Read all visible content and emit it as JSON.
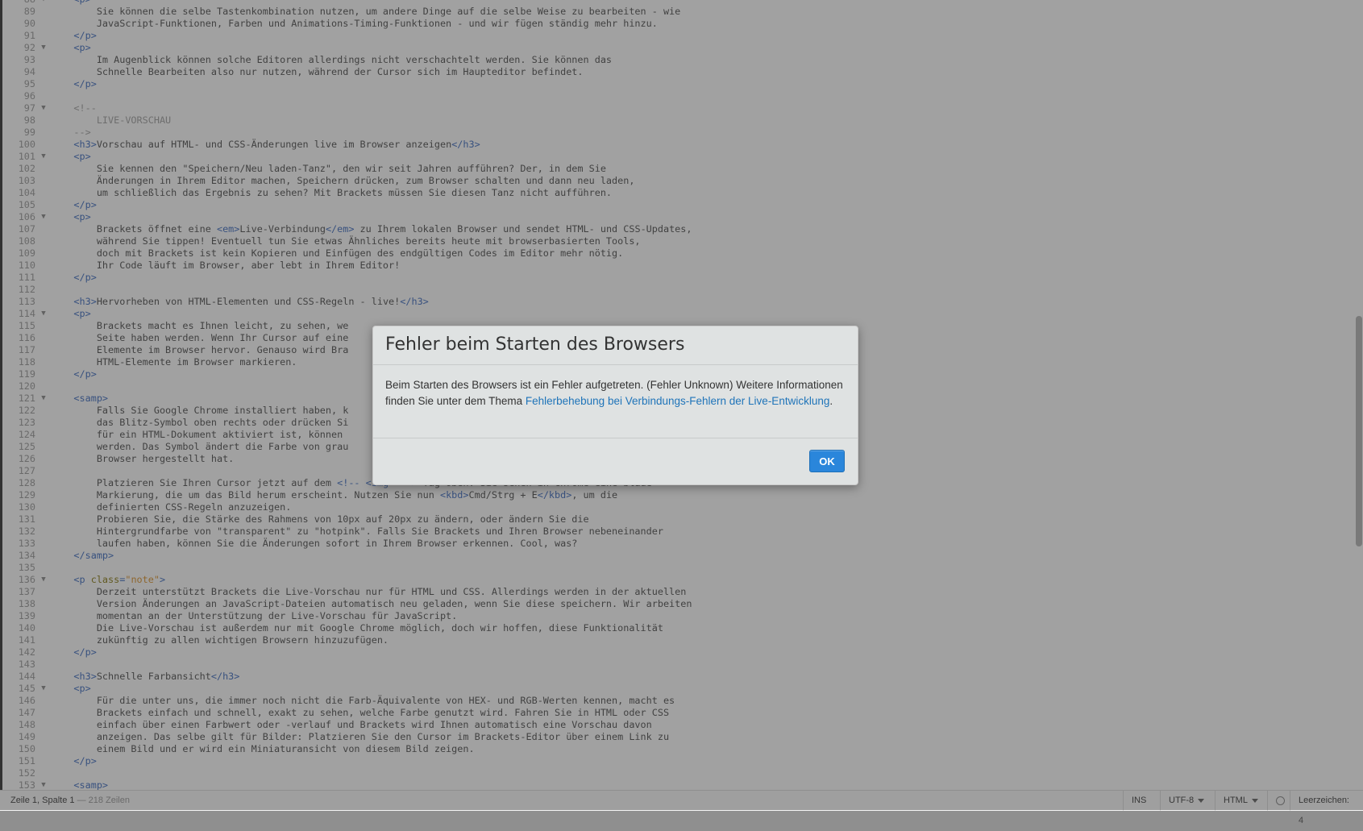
{
  "editor": {
    "lines": [
      {
        "n": "88",
        "fold": true,
        "parts": [
          [
            "tag",
            "    <p>"
          ]
        ]
      },
      {
        "n": "89",
        "parts": [
          [
            "txt",
            "        Sie können die selbe Tastenkombination nutzen, um andere Dinge auf die selbe Weise zu bearbeiten - wie"
          ]
        ]
      },
      {
        "n": "90",
        "parts": [
          [
            "txt",
            "        JavaScript-Funktionen, Farben und Animations-Timing-Funktionen - und wir fügen ständig mehr hinzu."
          ]
        ]
      },
      {
        "n": "91",
        "parts": [
          [
            "tag",
            "    </p>"
          ]
        ]
      },
      {
        "n": "92",
        "fold": true,
        "parts": [
          [
            "tag",
            "    <p>"
          ]
        ]
      },
      {
        "n": "93",
        "parts": [
          [
            "txt",
            "        Im Augenblick können solche Editoren allerdings nicht verschachtelt werden. Sie können das"
          ]
        ]
      },
      {
        "n": "94",
        "parts": [
          [
            "txt",
            "        Schnelle Bearbeiten also nur nutzen, während der Cursor sich im Haupteditor befindet."
          ]
        ]
      },
      {
        "n": "95",
        "parts": [
          [
            "tag",
            "    </p>"
          ]
        ]
      },
      {
        "n": "96",
        "parts": []
      },
      {
        "n": "97",
        "fold": true,
        "parts": [
          [
            "cmt",
            "    <!--"
          ]
        ]
      },
      {
        "n": "98",
        "parts": [
          [
            "cmt",
            "        LIVE-VORSCHAU"
          ]
        ]
      },
      {
        "n": "99",
        "parts": [
          [
            "cmt",
            "    -->"
          ]
        ]
      },
      {
        "n": "100",
        "parts": [
          [
            "tag",
            "    <h3>"
          ],
          [
            "txt",
            "Vorschau auf HTML- und CSS-Änderungen live im Browser anzeigen"
          ],
          [
            "tag",
            "</h3>"
          ]
        ]
      },
      {
        "n": "101",
        "fold": true,
        "parts": [
          [
            "tag",
            "    <p>"
          ]
        ]
      },
      {
        "n": "102",
        "parts": [
          [
            "txt",
            "        Sie kennen den \"Speichern/Neu laden-Tanz\", den wir seit Jahren aufführen? Der, in dem Sie"
          ]
        ]
      },
      {
        "n": "103",
        "parts": [
          [
            "txt",
            "        Änderungen in Ihrem Editor machen, Speichern drücken, zum Browser schalten und dann neu laden,"
          ]
        ]
      },
      {
        "n": "104",
        "parts": [
          [
            "txt",
            "        um schließlich das Ergebnis zu sehen? Mit Brackets müssen Sie diesen Tanz nicht aufführen."
          ]
        ]
      },
      {
        "n": "105",
        "parts": [
          [
            "tag",
            "    </p>"
          ]
        ]
      },
      {
        "n": "106",
        "fold": true,
        "parts": [
          [
            "tag",
            "    <p>"
          ]
        ]
      },
      {
        "n": "107",
        "parts": [
          [
            "txt",
            "        Brackets öffnet eine "
          ],
          [
            "tag",
            "<em>"
          ],
          [
            "txt",
            "Live-Verbindung"
          ],
          [
            "tag",
            "</em>"
          ],
          [
            "txt",
            " zu Ihrem lokalen Browser und sendet HTML- und CSS-Updates,"
          ]
        ]
      },
      {
        "n": "108",
        "parts": [
          [
            "txt",
            "        während Sie tippen! Eventuell tun Sie etwas Ähnliches bereits heute mit browserbasierten Tools,"
          ]
        ]
      },
      {
        "n": "109",
        "parts": [
          [
            "txt",
            "        doch mit Brackets ist kein Kopieren und Einfügen des endgültigen Codes im Editor mehr nötig."
          ]
        ]
      },
      {
        "n": "110",
        "parts": [
          [
            "txt",
            "        Ihr Code läuft im Browser, aber lebt in Ihrem Editor!"
          ]
        ]
      },
      {
        "n": "111",
        "parts": [
          [
            "tag",
            "    </p>"
          ]
        ]
      },
      {
        "n": "112",
        "parts": []
      },
      {
        "n": "113",
        "parts": [
          [
            "tag",
            "    <h3>"
          ],
          [
            "txt",
            "Hervorheben von HTML-Elementen und CSS-Regeln - live!"
          ],
          [
            "tag",
            "</h3>"
          ]
        ]
      },
      {
        "n": "114",
        "fold": true,
        "parts": [
          [
            "tag",
            "    <p>"
          ]
        ]
      },
      {
        "n": "115",
        "parts": [
          [
            "txt",
            "        Brackets macht es Ihnen leicht, zu sehen, we"
          ]
        ]
      },
      {
        "n": "116",
        "parts": [
          [
            "txt",
            "        Seite haben werden. Wenn Ihr Cursor auf eine"
          ]
        ]
      },
      {
        "n": "117",
        "parts": [
          [
            "txt",
            "        Elemente im Browser hervor. Genauso wird Bra"
          ]
        ]
      },
      {
        "n": "118",
        "parts": [
          [
            "txt",
            "        HTML-Elemente im Browser markieren."
          ]
        ]
      },
      {
        "n": "119",
        "parts": [
          [
            "tag",
            "    </p>"
          ]
        ]
      },
      {
        "n": "120",
        "parts": []
      },
      {
        "n": "121",
        "fold": true,
        "parts": [
          [
            "tag",
            "    <samp>"
          ]
        ]
      },
      {
        "n": "122",
        "parts": [
          [
            "txt",
            "        Falls Sie Google Chrome installiert haben, k"
          ]
        ]
      },
      {
        "n": "123",
        "parts": [
          [
            "txt",
            "        das Blitz-Symbol oben rechts oder drücken Si"
          ]
        ]
      },
      {
        "n": "124",
        "parts": [
          [
            "txt",
            "        für ein HTML-Dokument aktiviert ist, können"
          ]
        ]
      },
      {
        "n": "125",
        "parts": [
          [
            "txt",
            "        werden. Das Symbol ändert die Farbe von grau"
          ]
        ]
      },
      {
        "n": "126",
        "parts": [
          [
            "txt",
            "        Browser hergestellt hat."
          ]
        ]
      },
      {
        "n": "127",
        "parts": []
      },
      {
        "n": "128",
        "parts": [
          [
            "txt",
            "        Platzieren Sie Ihren Cursor jetzt auf dem "
          ],
          [
            "tag",
            "<!-- <img> -->"
          ],
          [
            "txt",
            "-Tag oben. Sie sehen in Chrome eine blaue"
          ]
        ]
      },
      {
        "n": "129",
        "parts": [
          [
            "txt",
            "        Markierung, die um das Bild herum erscheint. Nutzen Sie nun "
          ],
          [
            "tag",
            "<kbd>"
          ],
          [
            "txt",
            "Cmd/Strg + E"
          ],
          [
            "tag",
            "</kbd>"
          ],
          [
            "txt",
            ", um die"
          ]
        ]
      },
      {
        "n": "130",
        "parts": [
          [
            "txt",
            "        definierten CSS-Regeln anzuzeigen."
          ]
        ]
      },
      {
        "n": "131",
        "parts": [
          [
            "txt",
            "        Probieren Sie, die Stärke des Rahmens von 10px auf 20px zu ändern, oder ändern Sie die"
          ]
        ]
      },
      {
        "n": "132",
        "parts": [
          [
            "txt",
            "        Hintergrundfarbe von \"transparent\" zu \"hotpink\". Falls Sie Brackets und Ihren Browser nebeneinander"
          ]
        ]
      },
      {
        "n": "133",
        "parts": [
          [
            "txt",
            "        laufen haben, können Sie die Änderungen sofort in Ihrem Browser erkennen. Cool, was?"
          ]
        ]
      },
      {
        "n": "134",
        "parts": [
          [
            "tag",
            "    </samp>"
          ]
        ]
      },
      {
        "n": "135",
        "parts": []
      },
      {
        "n": "136",
        "fold": true,
        "parts": [
          [
            "tag",
            "    <p "
          ],
          [
            "attr",
            "class"
          ],
          [
            "tag",
            "="
          ],
          [
            "str",
            "\"note\""
          ],
          [
            "tag",
            ">"
          ]
        ]
      },
      {
        "n": "137",
        "parts": [
          [
            "txt",
            "        Derzeit unterstützt Brackets die Live-Vorschau nur für HTML und CSS. Allerdings werden in der aktuellen"
          ]
        ]
      },
      {
        "n": "138",
        "parts": [
          [
            "txt",
            "        Version Änderungen an JavaScript-Dateien automatisch neu geladen, wenn Sie diese speichern. Wir arbeiten"
          ]
        ]
      },
      {
        "n": "139",
        "parts": [
          [
            "txt",
            "        momentan an der Unterstützung der Live-Vorschau für JavaScript."
          ]
        ]
      },
      {
        "n": "140",
        "parts": [
          [
            "txt",
            "        Die Live-Vorschau ist außerdem nur mit Google Chrome möglich, doch wir hoffen, diese Funktionalität"
          ]
        ]
      },
      {
        "n": "141",
        "parts": [
          [
            "txt",
            "        zukünftig zu allen wichtigen Browsern hinzuzufügen."
          ]
        ]
      },
      {
        "n": "142",
        "parts": [
          [
            "tag",
            "    </p>"
          ]
        ]
      },
      {
        "n": "143",
        "parts": []
      },
      {
        "n": "144",
        "parts": [
          [
            "tag",
            "    <h3>"
          ],
          [
            "txt",
            "Schnelle Farbansicht"
          ],
          [
            "tag",
            "</h3>"
          ]
        ]
      },
      {
        "n": "145",
        "fold": true,
        "parts": [
          [
            "tag",
            "    <p>"
          ]
        ]
      },
      {
        "n": "146",
        "parts": [
          [
            "txt",
            "        Für die unter uns, die immer noch nicht die Farb-Äquivalente von HEX- und RGB-Werten kennen, macht es"
          ]
        ]
      },
      {
        "n": "147",
        "parts": [
          [
            "txt",
            "        Brackets einfach und schnell, exakt zu sehen, welche Farbe genutzt wird. Fahren Sie in HTML oder CSS"
          ]
        ]
      },
      {
        "n": "148",
        "parts": [
          [
            "txt",
            "        einfach über einen Farbwert oder -verlauf und Brackets wird Ihnen automatisch eine Vorschau davon"
          ]
        ]
      },
      {
        "n": "149",
        "parts": [
          [
            "txt",
            "        anzeigen. Das selbe gilt für Bilder: Platzieren Sie den Cursor im Brackets-Editor über einem Link zu"
          ]
        ]
      },
      {
        "n": "150",
        "parts": [
          [
            "txt",
            "        einem Bild und er wird ein Miniaturansicht von diesem Bild zeigen."
          ]
        ]
      },
      {
        "n": "151",
        "parts": [
          [
            "tag",
            "    </p>"
          ]
        ]
      },
      {
        "n": "152",
        "parts": []
      },
      {
        "n": "153",
        "fold": true,
        "parts": [
          [
            "tag",
            "    <samp>"
          ]
        ]
      }
    ]
  },
  "statusbar": {
    "position": "Zeile 1, Spalte 1",
    "lines_count": "— 218 Zeilen",
    "mode": "INS",
    "encoding": "UTF-8",
    "language": "HTML",
    "indent": "Leerzeichen: 4"
  },
  "dialog": {
    "title": "Fehler beim Starten des Browsers",
    "message_before": "Beim Starten des Browsers ist ein Fehler aufgetreten. (Fehler Unknown) Weitere Informationen finden Sie unter dem Thema ",
    "link_text": "Fehlerbehebung bei Verbindungs-Fehlern der Live-Entwicklung",
    "message_after": ".",
    "ok_label": "OK"
  },
  "colors": {
    "accent": "#2a86db",
    "link": "#1f74b9",
    "tag": "#446fbd"
  }
}
